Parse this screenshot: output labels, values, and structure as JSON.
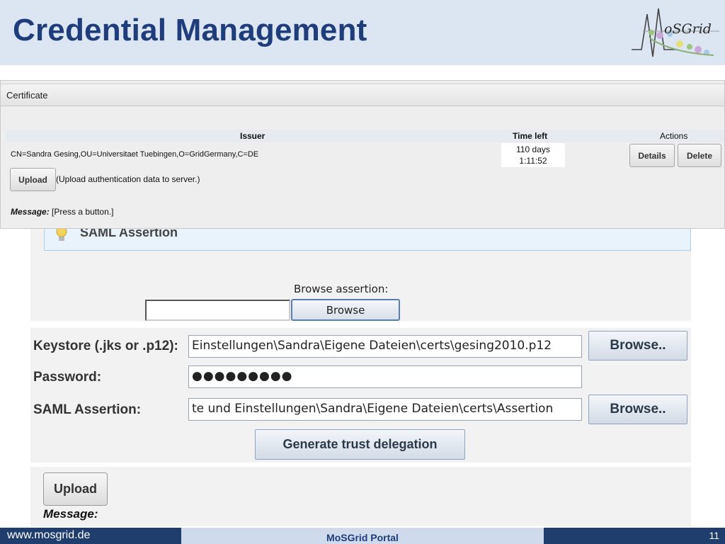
{
  "slide": {
    "title": "Credential Management",
    "logo_text": "oSGrid"
  },
  "certificate_portlet": {
    "title": "Certificate",
    "columns": {
      "issuer": "Issuer",
      "time_left": "Time left",
      "actions": "Actions"
    },
    "row": {
      "issuer": "CN=Sandra Gesing,OU=Universitaet Tuebingen,O=GridGermany,C=DE",
      "time_left_days": "110 days",
      "time_left_time": "1:11:52"
    },
    "details_label": "Details",
    "delete_label": "Delete",
    "upload_label": "Upload",
    "upload_description": "(Upload authentication data to server.)",
    "message_label": "Message:",
    "message_text": "[Press a button.]"
  },
  "saml_portlet": {
    "title": "SAML Assertion",
    "browse_label": "Browse assertion:",
    "browse_value": "",
    "browse_button": "Browse"
  },
  "keystore_form": {
    "keystore_label": "Keystore (.jks or .p12):",
    "keystore_value": "Einstellungen\\Sandra\\Eigene Dateien\\certs\\gesing2010.p12",
    "password_label": "Password:",
    "password_value": "●●●●●●●●●",
    "saml_label": "SAML Assertion:",
    "saml_value": "te und Einstellungen\\Sandra\\Eigene Dateien\\certs\\Assertion",
    "browse_label": "Browse..",
    "generate_label": "Generate trust delegation"
  },
  "upload_area": {
    "upload_label": "Upload",
    "message_label": "Message:"
  },
  "footer": {
    "url": "www.mosgrid.de",
    "center": "MoSGrid Portal",
    "page": "11"
  },
  "colors": {
    "title": "#1f3d7a",
    "footer_dark": "#1f3d6d",
    "footer_light": "#cfdbec",
    "header_bg": "#dce6f2"
  },
  "icons": [
    "mosgrid-logo-icon",
    "lightbulb-icon"
  ]
}
